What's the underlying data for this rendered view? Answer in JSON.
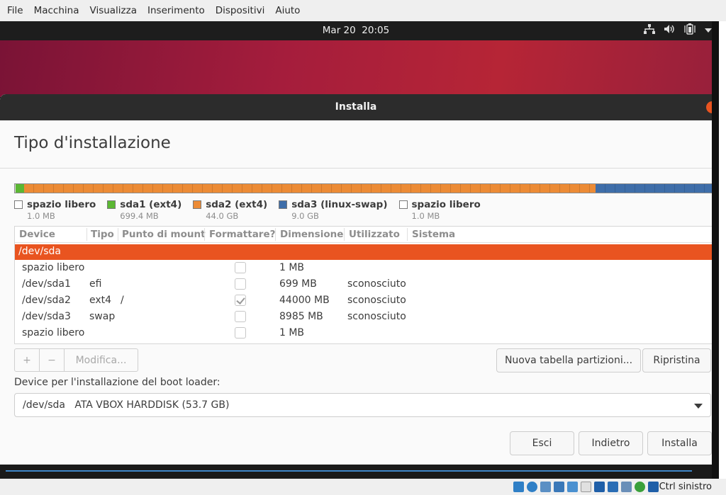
{
  "host_menu": [
    "File",
    "Macchina",
    "Visualizza",
    "Inserimento",
    "Dispositivi",
    "Aiuto"
  ],
  "topbar": {
    "clock": "Mar 20  20:05",
    "icons": [
      "network-icon",
      "volume-icon",
      "battery-icon",
      "menu-arrow-icon"
    ]
  },
  "window": {
    "title": "Installa",
    "heading": "Tipo d'installazione"
  },
  "legend": [
    {
      "label": "spazio libero",
      "size": "1.0 MB",
      "color": "#ffffff"
    },
    {
      "label": "sda1 (ext4)",
      "size": "699.4 MB",
      "color": "#5bb733"
    },
    {
      "label": "sda2 (ext4)",
      "size": "44.0 GB",
      "color": "#ec8b36"
    },
    {
      "label": "sda3 (linux-swap)",
      "size": "9.0 GB",
      "color": "#3f6ea9"
    },
    {
      "label": "spazio libero",
      "size": "1.0 MB",
      "color": "#ffffff"
    }
  ],
  "table": {
    "headers": [
      "Device",
      "Tipo",
      "Punto di mount",
      "Formattare?",
      "Dimensione",
      "Utilizzato",
      "Sistema"
    ],
    "disk": "/dev/sda",
    "rows": [
      {
        "device": "spazio libero",
        "type": "",
        "mount": "",
        "format": false,
        "size": "1 MB",
        "used": "",
        "system": ""
      },
      {
        "device": "/dev/sda1",
        "type": "efi",
        "mount": "",
        "format": false,
        "size": "699 MB",
        "used": "sconosciuto",
        "system": ""
      },
      {
        "device": "/dev/sda2",
        "type": "ext4",
        "mount": "/",
        "format": true,
        "size": "44000 MB",
        "used": "sconosciuto",
        "system": ""
      },
      {
        "device": "/dev/sda3",
        "type": "swap",
        "mount": "",
        "format": false,
        "size": "8985 MB",
        "used": "sconosciuto",
        "system": ""
      },
      {
        "device": "spazio libero",
        "type": "",
        "mount": "",
        "format": false,
        "size": "1 MB",
        "used": "",
        "system": ""
      }
    ]
  },
  "toolbar": {
    "add": "+",
    "remove": "−",
    "edit": "Modifica...",
    "new_table": "Nuova tabella partizioni...",
    "revert": "Ripristina"
  },
  "bootloader": {
    "label": "Device per l'installazione del boot loader:",
    "value": "/dev/sda   ATA VBOX HARDDISK (53.7 GB)"
  },
  "actions": {
    "quit": "Esci",
    "back": "Indietro",
    "install": "Installa"
  },
  "statusbar": {
    "host_key": "Ctrl sinistro"
  },
  "colors": {
    "accent": "#e95420",
    "titlebar": "#2c2c2c"
  }
}
